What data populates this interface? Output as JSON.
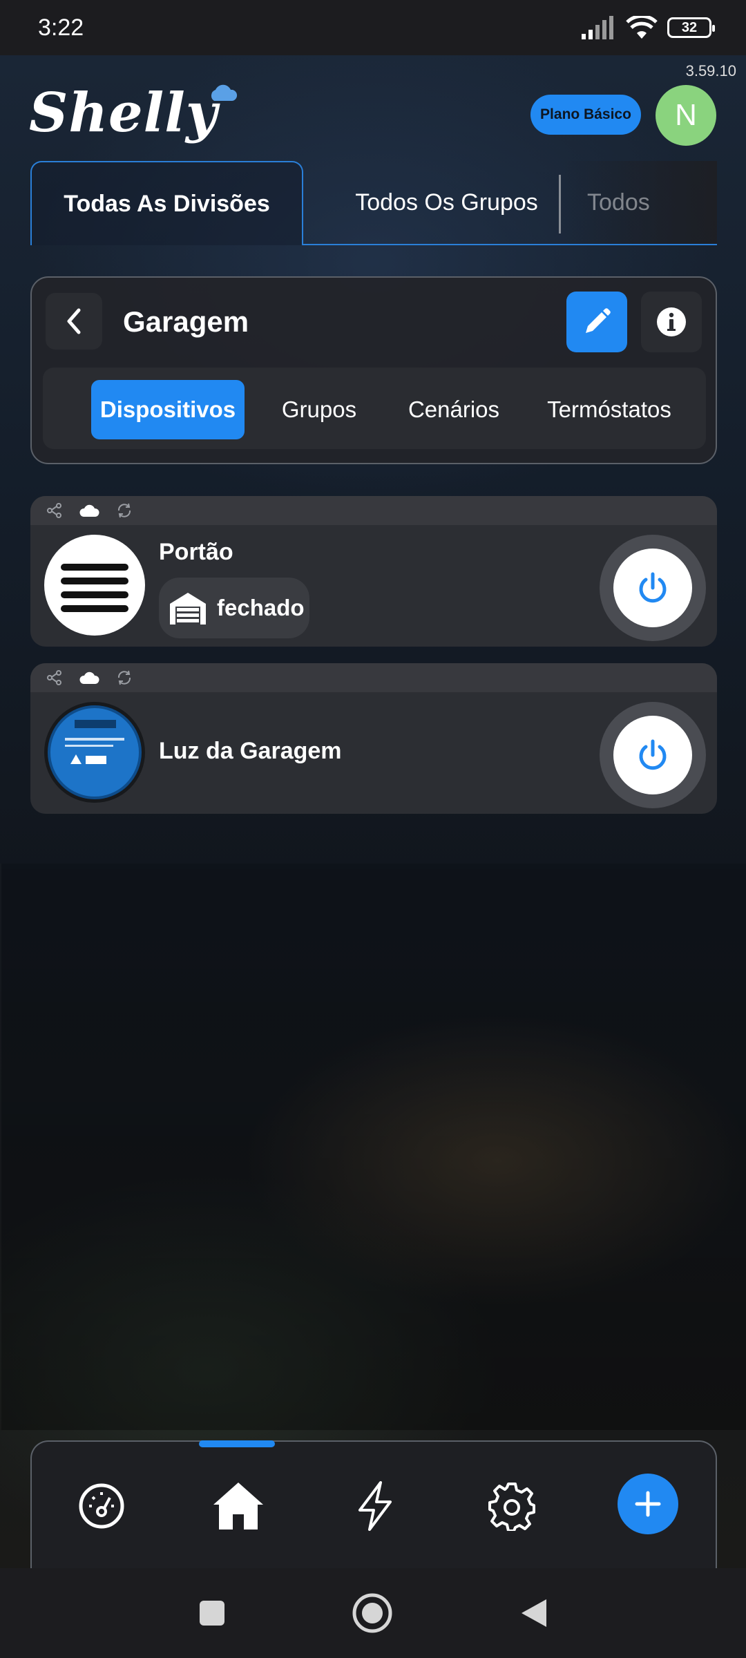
{
  "status_bar": {
    "time": "3:22",
    "battery": "32"
  },
  "app": {
    "version": "3.59.10",
    "logo_text": "Shelly",
    "plan_badge": "Plano Básico",
    "avatar_initial": "N"
  },
  "top_tabs": [
    {
      "label": "Todas As Divisões",
      "active": true
    },
    {
      "label": "Todos Os Grupos",
      "active": false
    },
    {
      "label": "Todos",
      "active": false
    }
  ],
  "room": {
    "title": "Garagem",
    "subtabs": [
      {
        "label": "Dispositivos",
        "active": true
      },
      {
        "label": "Grupos",
        "active": false
      },
      {
        "label": "Cenários",
        "active": false
      },
      {
        "label": "Termóstatos",
        "active": false
      }
    ]
  },
  "devices": [
    {
      "name": "Portão",
      "state": "fechado",
      "icons": [
        "share-icon",
        "cloud-icon",
        "sync-icon"
      ]
    },
    {
      "name": "Luz da Garagem",
      "icons": [
        "share-icon",
        "cloud-icon",
        "sync-icon"
      ]
    }
  ],
  "bottom_nav": [
    "dashboard-icon",
    "home-icon",
    "bolt-icon",
    "settings-icon",
    "plus-icon"
  ],
  "colors": {
    "accent": "#2189f2",
    "avatar": "#8ad37e",
    "card": "#2c2e33"
  }
}
